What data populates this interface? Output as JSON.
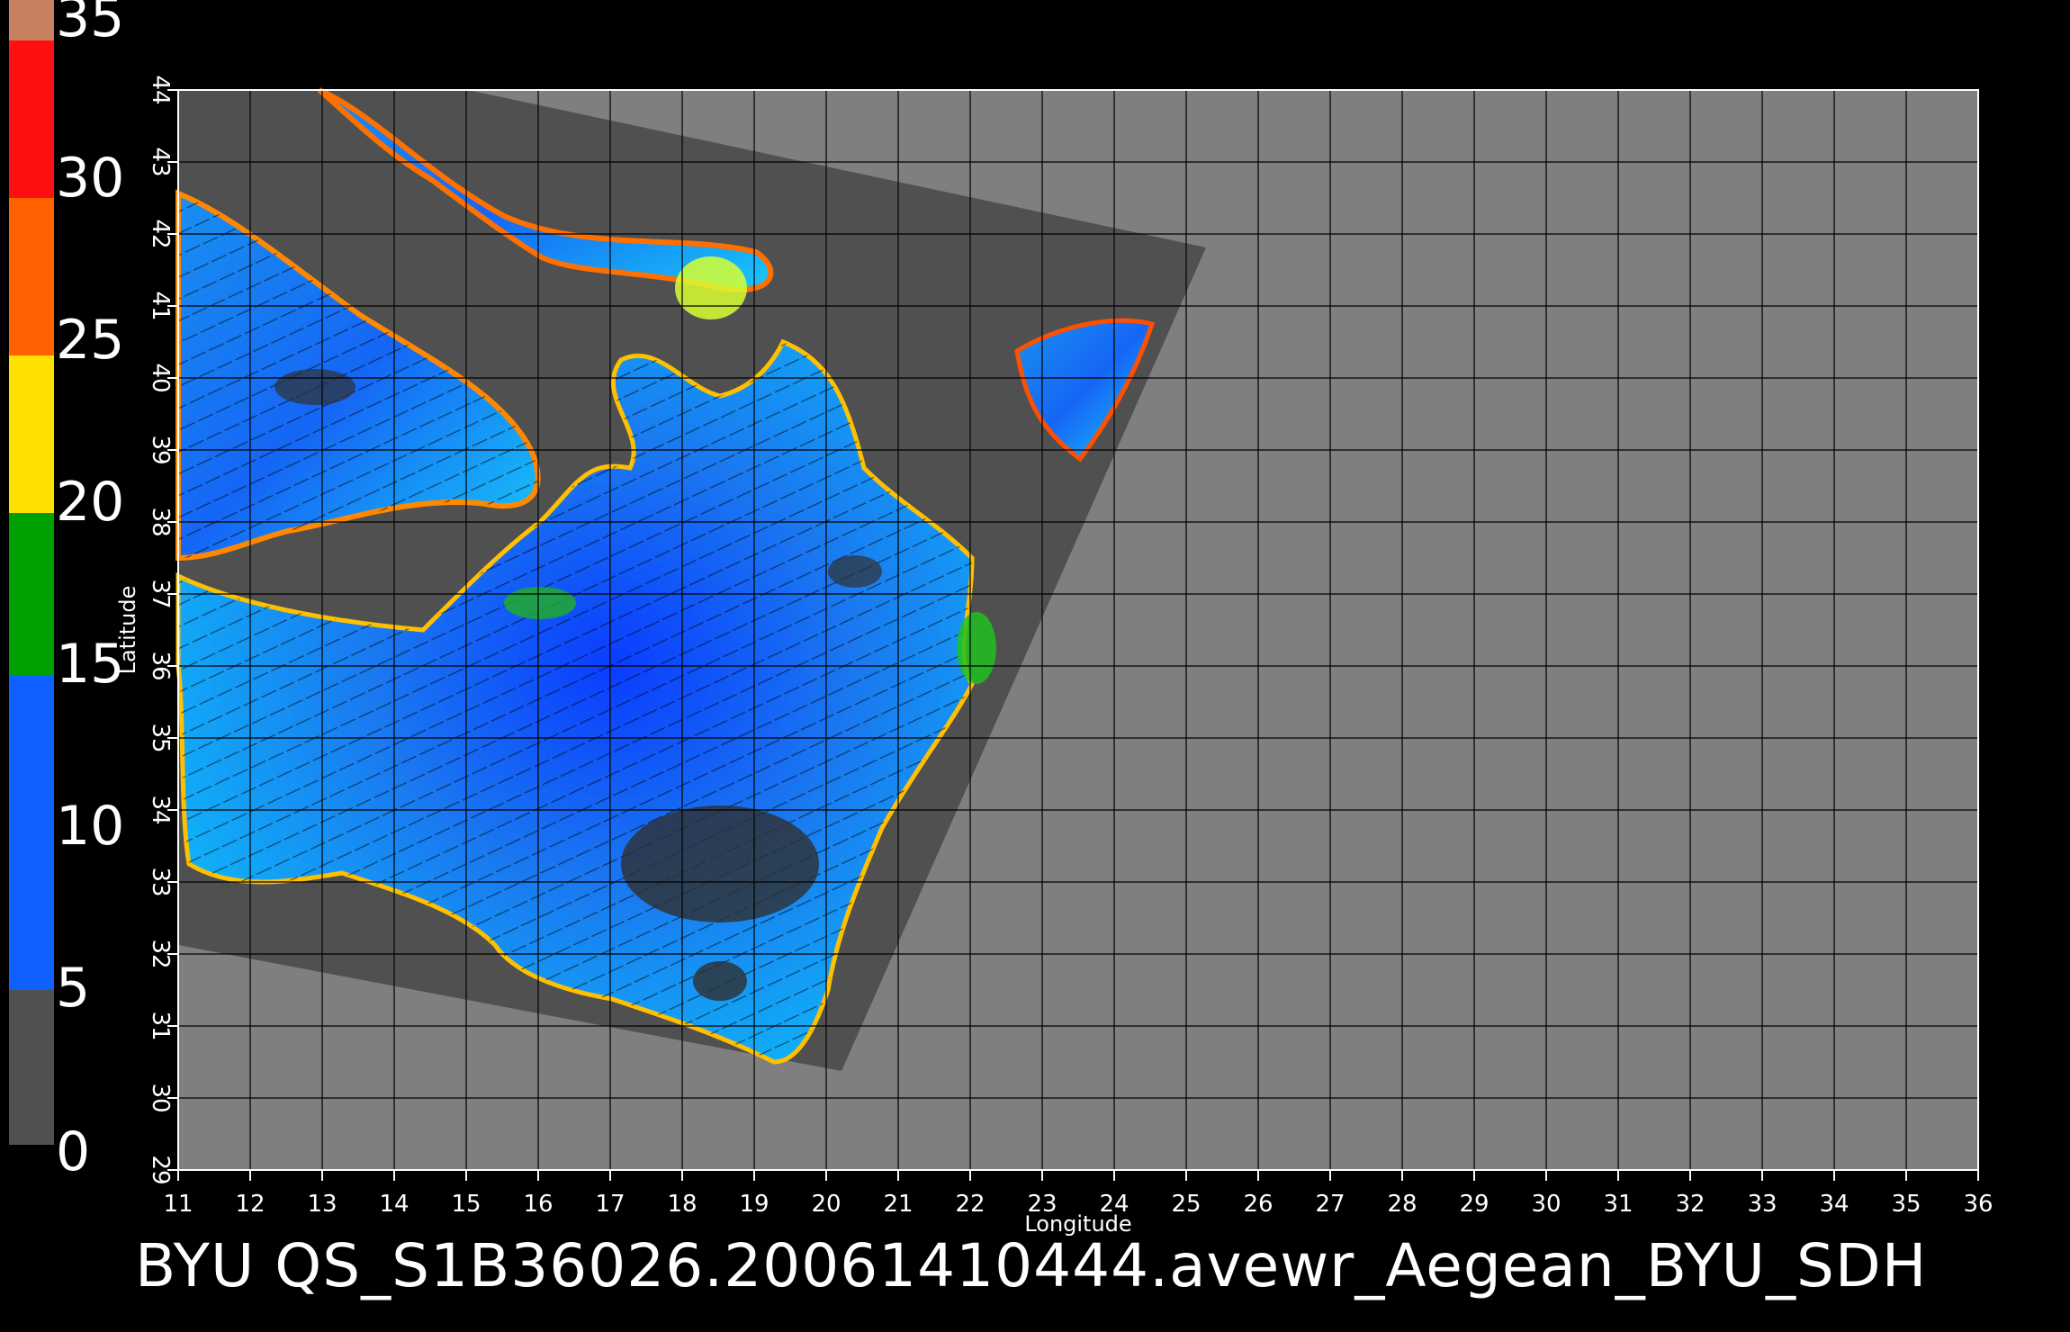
{
  "caption": "BYU  QS_S1B36026.20061410444.avewr_Aegean_BYU_SDH",
  "axes": {
    "xlabel": "Longitude",
    "ylabel": "Latitude",
    "lon_ticks": [
      "11",
      "12",
      "13",
      "14",
      "15",
      "16",
      "17",
      "18",
      "19",
      "20",
      "21",
      "22",
      "23",
      "24",
      "25",
      "26",
      "27",
      "28",
      "29",
      "30",
      "31",
      "32",
      "33",
      "34",
      "35",
      "36"
    ],
    "lat_ticks": [
      "29",
      "30",
      "31",
      "32",
      "33",
      "34",
      "35",
      "36",
      "37",
      "38",
      "39",
      "40",
      "41",
      "42",
      "43",
      "44"
    ]
  },
  "colorbar": {
    "labels": [
      "35",
      "30",
      "25",
      "20",
      "15",
      "10",
      "5",
      "0"
    ],
    "colors": {
      "land": "#7f7f7f",
      "swath_no_data": "#505050",
      "low": "#00ffff",
      "mid": "#0040ff",
      "green": "#00b000",
      "yellow": "#ffff00",
      "orange": "#ff6000",
      "red": "#ff1010",
      "top": "#d08060"
    }
  }
}
